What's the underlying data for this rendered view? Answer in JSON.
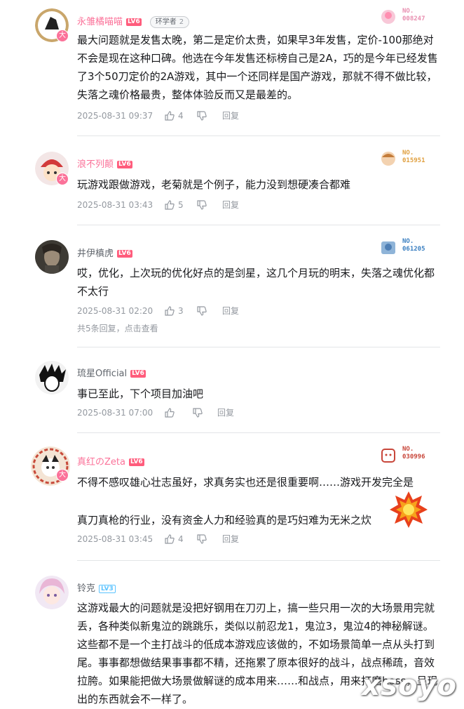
{
  "comments": [
    {
      "username": "永雏橘喵喵",
      "level": "LV6",
      "tag": "环学者",
      "tag_num": "2",
      "fan_label": "NO.",
      "fan_no": "008247",
      "text": "最大问题就是发售太晚，第二是定价太贵，如果早3年发售，定价-100那绝对不会是现在这种口碑。他选在今年发售还标榜自己是2A，巧的是今年已经发售了3个50刀定价的2A游戏，其中一个还同样是国产游戏，那就不得不做比较，失落之魂价格最贵，整体体验反而又是最差的。",
      "time": "2025-08-31 09:37",
      "likes": "4",
      "reply_label": "回复",
      "badge": "大"
    },
    {
      "username": "浪不列颠",
      "level": "LV6",
      "fan_label": "NO.",
      "fan_no": "015951",
      "text": "玩游戏跟做游戏，老菊就是个例子，能力没到想硬凑合都难",
      "time": "2025-08-31 03:43",
      "likes": "5",
      "reply_label": "回复",
      "badge": "大"
    },
    {
      "username": "井伊槙虎",
      "level": "LV6",
      "fan_label": "NO.",
      "fan_no": "061205",
      "text": "哎，优化，上次玩的优化好点的是剑星，这几个月玩的明末，失落之魂优化都不太行",
      "time": "2025-08-31 02:20",
      "likes": "3",
      "reply_label": "回复",
      "replies_text": "共5条回复，点击查看"
    },
    {
      "username": "琉星Official",
      "level": "LV6",
      "text": "事已至此，下个项目加油吧",
      "time": "2025-08-31 07:00",
      "likes": "",
      "reply_label": "回复"
    },
    {
      "username": "真红のZeta",
      "level": "LV6",
      "fan_label": "NO.",
      "fan_no": "030996",
      "text_line1": "不得不感叹雄心壮志虽好，求真务实也还是很重要啊……游戏开发完全是",
      "text_line2": "真刀真枪的行业，没有资金人力和经验真的是巧妇难为无米之炊",
      "time": "2025-08-31 03:45",
      "likes": "4",
      "reply_label": "回复",
      "badge": "大"
    },
    {
      "username": "铃克",
      "level": "LV3",
      "text": "这游戏最大的问题就是没把好钢用在刀刃上，搞一些只用一次的大场景用完就丢，各种类似新鬼泣的跳跳乐，类似以前忍龙1，鬼泣3，鬼泣4的神秘解谜。这些都不是一个主打战斗的低成本游戏应该做的，不如场景简单一点从头打到尾。事事都想做结果事事都不精，还拖累了原本很好的战斗，战点稀疏，音效拉胯。如果能把做大场景做解谜的成本用来……和战点，用来打磨boss，呈现出的东西就会不一样了。"
    }
  ],
  "watermark": "xsoyo"
}
